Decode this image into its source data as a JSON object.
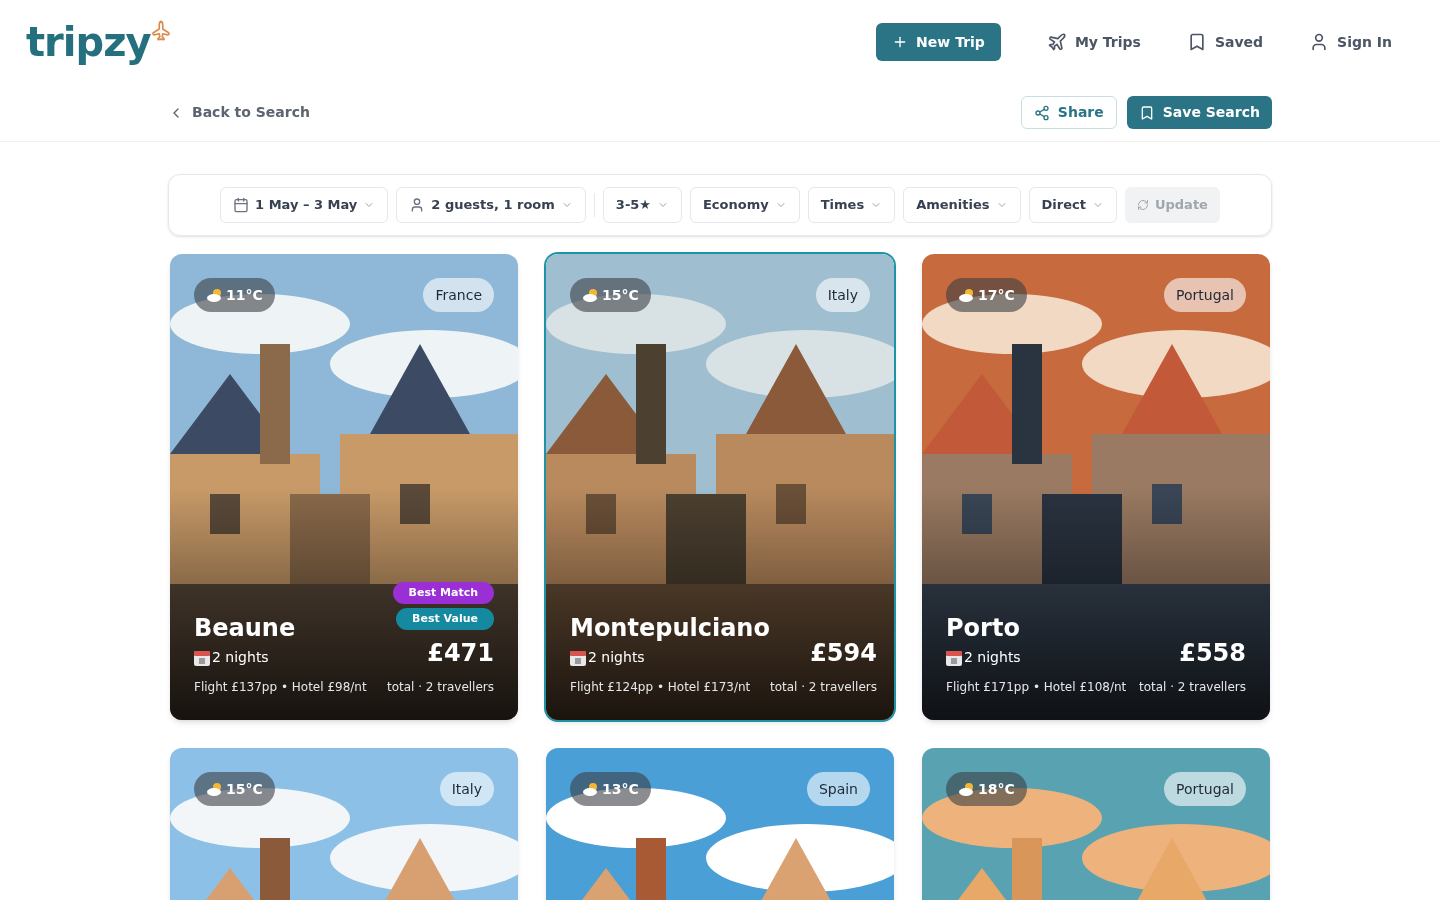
{
  "header": {
    "logo": "tripzy",
    "new_trip": "New Trip",
    "nav": [
      {
        "label": "My Trips",
        "kind": "trips"
      },
      {
        "label": "Saved",
        "kind": "saved"
      },
      {
        "label": "Sign In",
        "kind": "user"
      }
    ]
  },
  "subbar": {
    "back": "Back to Search",
    "share": "Share",
    "save_search": "Save Search"
  },
  "filters": [
    {
      "label": "1 May – 3 May",
      "kind": "date"
    },
    {
      "label": "2 guests, 1 room",
      "kind": "guests"
    },
    {
      "label": "3-5★",
      "kind": "plain"
    },
    {
      "label": "Economy",
      "kind": "plain"
    },
    {
      "label": "Times",
      "kind": "plain"
    },
    {
      "label": "Amenities",
      "kind": "plain"
    },
    {
      "label": "Direct",
      "kind": "plain"
    }
  ],
  "update": {
    "label": "Update",
    "disabled": true
  },
  "cards": [
    {
      "temp": "11°C",
      "country": "France",
      "city": "Beaune",
      "nights": "2 nights",
      "breakdown": "Flight £137pp • Hotel £98/nt",
      "price": "£471",
      "price_note": "total · 2 travellers",
      "selected": false,
      "badges": [
        {
          "label": "Best Match",
          "kind": "match"
        },
        {
          "label": "Best Value",
          "kind": "value"
        }
      ]
    },
    {
      "temp": "15°C",
      "country": "Italy",
      "city": "Montepulciano",
      "nights": "2 nights",
      "breakdown": "Flight £124pp • Hotel £173/nt",
      "price": "£594",
      "price_note": "total · 2 travellers",
      "selected": true
    },
    {
      "temp": "17°C",
      "country": "Portugal",
      "city": "Porto",
      "nights": "2 nights",
      "breakdown": "Flight £171pp • Hotel £108/nt",
      "price": "£558",
      "price_note": "total · 2 travellers",
      "selected": false
    },
    {
      "temp": "15°C",
      "country": "Italy",
      "selected": false
    },
    {
      "temp": "13°C",
      "country": "Spain",
      "selected": false
    },
    {
      "temp": "18°C",
      "country": "Portugal",
      "selected": false
    }
  ]
}
